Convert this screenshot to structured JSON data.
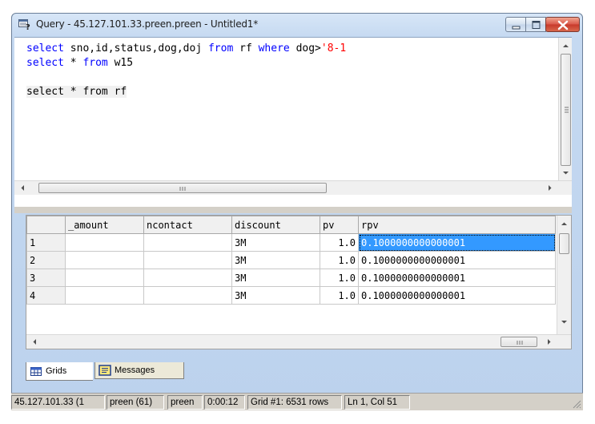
{
  "window": {
    "title": "Query - 45.127.101.33.preen.preen - Untitled1*"
  },
  "editor": {
    "lines": [
      [
        {
          "t": "select ",
          "c": "kw"
        },
        {
          "t": "sno,id,status,dog,doj ",
          "c": "plain"
        },
        {
          "t": "from ",
          "c": "kw"
        },
        {
          "t": "rf ",
          "c": "plain"
        },
        {
          "t": "where ",
          "c": "kw"
        },
        {
          "t": "dog>",
          "c": "plain"
        },
        {
          "t": "'8-1",
          "c": "str"
        }
      ],
      [
        {
          "t": "select ",
          "c": "kw"
        },
        {
          "t": "* ",
          "c": "plain"
        },
        {
          "t": "from ",
          "c": "kw"
        },
        {
          "t": "w15",
          "c": "plain"
        }
      ],
      [],
      [
        {
          "t": "select ",
          "c": "plain",
          "hl": true
        },
        {
          "t": "* ",
          "c": "plain",
          "hl": true
        },
        {
          "t": "from ",
          "c": "plain",
          "hl": true
        },
        {
          "t": "rf",
          "c": "plain",
          "hl": true
        }
      ]
    ]
  },
  "grid": {
    "columns": [
      "_amount",
      "ncontact",
      "discount",
      "pv",
      "rpv"
    ],
    "rows": [
      {
        "n": "1",
        "cells": [
          "",
          "",
          "3M",
          "1.0",
          "0.1000000000000001"
        ]
      },
      {
        "n": "2",
        "cells": [
          "",
          "",
          "3M",
          "1.0",
          "0.1000000000000001"
        ]
      },
      {
        "n": "3",
        "cells": [
          "",
          "",
          "3M",
          "1.0",
          "0.1000000000000001"
        ]
      },
      {
        "n": "4",
        "cells": [
          "",
          "",
          "3M",
          "1.0",
          "0.1000000000000001"
        ]
      }
    ],
    "selected": {
      "row": 0,
      "col": 4
    }
  },
  "tabs": {
    "grids": "Grids",
    "messages": "Messages"
  },
  "status": {
    "server": "45.127.101.33 (1",
    "user": "preen (61)",
    "db": "preen",
    "elapsed": "0:00:12",
    "rows": "Grid #1: 6531 rows",
    "position": "Ln 1, Col 51"
  },
  "icons": {
    "app": "query-window-icon",
    "minimize": "minimize-icon",
    "maximize": "maximize-icon",
    "close": "close-icon",
    "grid": "grid-icon",
    "messages": "messages-icon"
  }
}
